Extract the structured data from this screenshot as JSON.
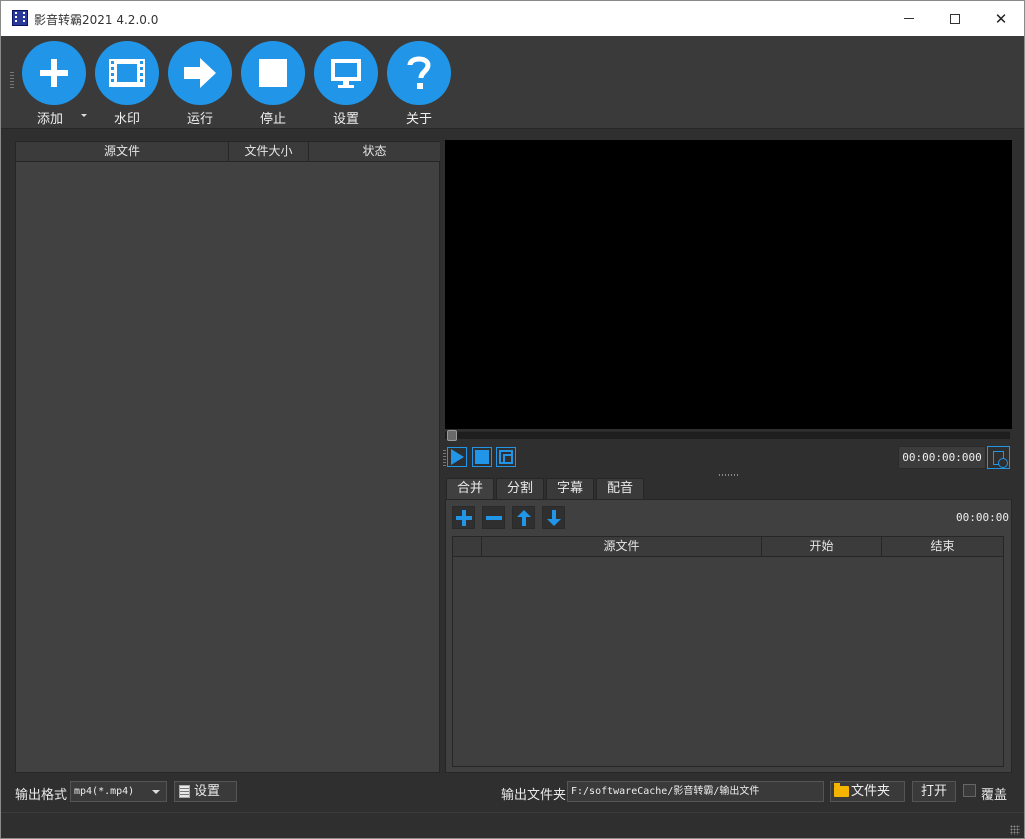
{
  "window": {
    "title": "影音转霸2021 4.2.0.0",
    "min_icon": "minimize-icon",
    "max_icon": "maximize-icon",
    "close_glyph": "✕"
  },
  "toolbar": {
    "add": {
      "label": "添加",
      "icon": "plus-icon"
    },
    "watermark": {
      "label": "水印",
      "icon": "film-icon"
    },
    "run": {
      "label": "运行",
      "icon": "arrow-right-icon"
    },
    "stop": {
      "label": "停止",
      "icon": "stop-icon"
    },
    "settings": {
      "label": "设置",
      "icon": "monitor-icon"
    },
    "about": {
      "label": "关于",
      "icon": "question-icon"
    }
  },
  "file_list": {
    "columns": [
      "源文件",
      "文件大小",
      "状态"
    ],
    "rows": []
  },
  "player": {
    "position_time": "00:00:00:000",
    "icons": [
      "play-icon",
      "stop-icon",
      "fullscreen-icon",
      "clock-file-icon"
    ]
  },
  "tabs": [
    "合并",
    "分割",
    "字幕",
    "配音"
  ],
  "merge": {
    "total_time": "00:00:00",
    "columns": [
      "源文件",
      "开始",
      "结束"
    ],
    "rows": []
  },
  "bottom": {
    "format_label": "输出格式",
    "format_value": "mp4(*.mp4)",
    "format_settings_label": "设置",
    "output_folder_label": "输出文件夹",
    "output_path": "F:/softwareCache/影音转霸/输出文件",
    "folder_button_label": "文件夹",
    "open_button_label": "打开",
    "overwrite_label": "覆盖",
    "overwrite_checked": false
  },
  "colors": {
    "accent": "#2196e8",
    "background": "#2f2f2f",
    "panel": "#414141",
    "video": "#000000"
  }
}
